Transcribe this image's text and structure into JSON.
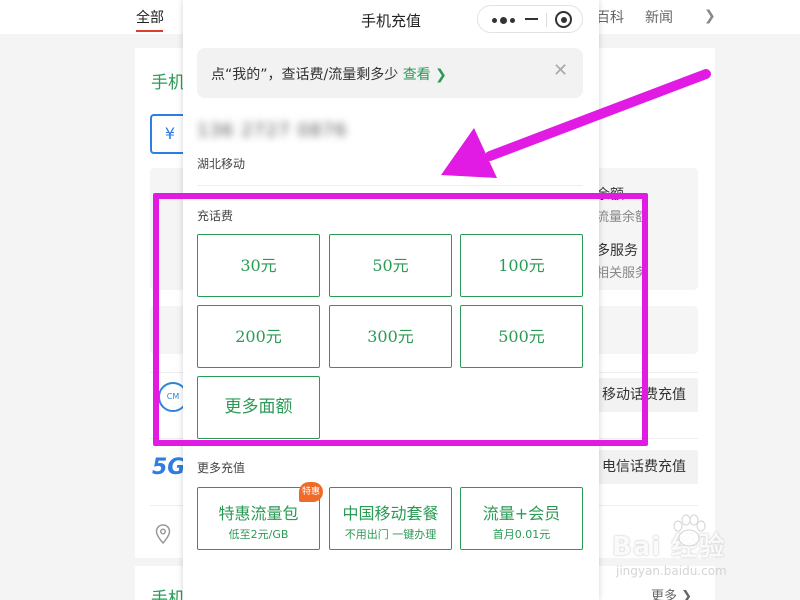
{
  "background": {
    "tabs": [
      {
        "label": "全部",
        "active": true
      },
      {
        "label": "百科",
        "active": false
      },
      {
        "label": "新闻",
        "active": false
      }
    ],
    "card_title": "手机",
    "card_title2": "手机",
    "wallet_icon": "wallet-yen-icon",
    "right_texts": {
      "balance_title": "余额",
      "balance_sub": "流量余额",
      "more_services": "多服务",
      "related_services": "相关服务"
    },
    "mobile_recharge_button": "移动话费充值",
    "telecom_recharge_button": "电信话费充值",
    "more_link": "更多"
  },
  "watermark": {
    "brand": "Bai 经验",
    "url": "jingyan.baidu.com"
  },
  "phone": {
    "title": "手机充值",
    "capsule": {
      "more_icon": "more-dots-icon",
      "minimize_icon": "minus-icon",
      "close_icon": "target-circle-icon"
    },
    "notice": {
      "text": "点“我的”，查话费/流量剩多少",
      "link": "查看",
      "close_icon": "close-icon"
    },
    "phone_number": "136 2727 0876",
    "carrier": "湖北移动",
    "recharge_label": "充话费",
    "amounts": [
      "30元",
      "50元",
      "100元",
      "200元",
      "300元",
      "500元",
      "更多面额"
    ],
    "more_recharge_label": "更多充值",
    "more_cards": [
      {
        "title": "特惠流量包",
        "sub": "低至2元/GB",
        "badge": "特惠"
      },
      {
        "title": "中国移动套餐",
        "sub": "不用出门 一键办理",
        "badge": ""
      },
      {
        "title": "流量+会员",
        "sub": "首月0.01元",
        "badge": ""
      }
    ]
  },
  "annotations": {
    "highlight_color": "#e11be3",
    "arrow_color": "#e11be3"
  },
  "colors": {
    "accent_green": "#2b9a55",
    "badge_orange": "#f06a28"
  }
}
